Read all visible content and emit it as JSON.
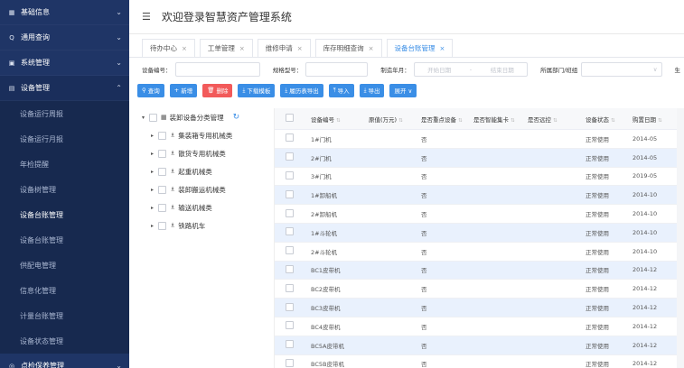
{
  "sidebar": {
    "groups_top": [
      {
        "icon": "▦",
        "label": "基础信息"
      },
      {
        "icon": "Q",
        "label": "通用查询"
      },
      {
        "icon": "▣",
        "label": "系统管理"
      }
    ],
    "equipment": {
      "icon": "▤",
      "label": "设备管理"
    },
    "sub_items": [
      "设备运行周报",
      "设备运行月报",
      "年检提醒",
      "设备树管理",
      "设备台账管理",
      "设备台账管理",
      "供配电管理",
      "信息化管理",
      "计量台账管理",
      "设备状态管理"
    ],
    "active_index": 4,
    "bottom_group": {
      "icon": "◎",
      "label": "点检保养管理"
    },
    "chevron_down": "⌄",
    "chevron_up": "⌃"
  },
  "header": {
    "menu_icon": "☰",
    "title": "欢迎登录智慧资产管理系统"
  },
  "tabs": [
    {
      "label": "待办中心",
      "active": false
    },
    {
      "label": "工单管理",
      "active": false
    },
    {
      "label": "维修申请",
      "active": false
    },
    {
      "label": "库存明细查询",
      "active": false
    },
    {
      "label": "设备台账管理",
      "active": true
    }
  ],
  "tab_close": "×",
  "filters": {
    "code_label": "设备编号：",
    "model_label": "规格型号：",
    "year_label": "制造年月：",
    "date_start": "开始日期",
    "date_sep": "-",
    "date_end": "结束日期",
    "dept_label": "所属部门/班组",
    "dept_arrow": "∨",
    "trailing": "生"
  },
  "actions": [
    {
      "icon": "⚲",
      "label": "查询",
      "color": "blue"
    },
    {
      "icon": "+",
      "label": "新增",
      "color": "blue"
    },
    {
      "icon": "🗑",
      "label": "删除",
      "color": "red"
    },
    {
      "icon": "⤓",
      "label": "下载模板",
      "color": "blue"
    },
    {
      "icon": "⤓",
      "label": "履历表导出",
      "color": "blue"
    },
    {
      "icon": "⤒",
      "label": "导入",
      "color": "blue"
    },
    {
      "icon": "⤓",
      "label": "导出",
      "color": "blue"
    },
    {
      "icon": "",
      "label": "展开 ∨",
      "color": "blue"
    }
  ],
  "tree": {
    "root": "装卸设备分类管理",
    "refresh_icon": "↻",
    "children": [
      "集装箱专用机械类",
      "散货专用机械类",
      "起重机械类",
      "装卸搬运机械类",
      "输送机械类",
      "铁路机车"
    ]
  },
  "table": {
    "headers": {
      "code": "设备编号",
      "orig": "原值(万元)",
      "key": "是否重点设备",
      "smart": "是否智能集卡",
      "remote": "是否远控",
      "status": "设备状态",
      "date": "购置日期"
    },
    "rows": [
      {
        "code": "1#门机",
        "key": "否",
        "status": "正常使用",
        "date": "2014-05"
      },
      {
        "code": "2#门机",
        "key": "否",
        "status": "正常使用",
        "date": "2014-05"
      },
      {
        "code": "3#门机",
        "key": "否",
        "status": "正常使用",
        "date": "2019-05"
      },
      {
        "code": "1#卸船机",
        "key": "否",
        "status": "正常使用",
        "date": "2014-10"
      },
      {
        "code": "2#卸船机",
        "key": "否",
        "status": "正常使用",
        "date": "2014-10"
      },
      {
        "code": "1#斗轮机",
        "key": "否",
        "status": "正常使用",
        "date": "2014-10"
      },
      {
        "code": "2#斗轮机",
        "key": "否",
        "status": "正常使用",
        "date": "2014-10"
      },
      {
        "code": "BC1皮带机",
        "key": "否",
        "status": "正常使用",
        "date": "2014-12"
      },
      {
        "code": "BC2皮带机",
        "key": "否",
        "status": "正常使用",
        "date": "2014-12"
      },
      {
        "code": "BC3皮带机",
        "key": "否",
        "status": "正常使用",
        "date": "2014-12"
      },
      {
        "code": "BC4皮带机",
        "key": "否",
        "status": "正常使用",
        "date": "2014-12"
      },
      {
        "code": "BC5A皮带机",
        "key": "否",
        "status": "正常使用",
        "date": "2014-12"
      },
      {
        "code": "BC5B皮带机",
        "key": "否",
        "status": "正常使用",
        "date": "2014-12"
      }
    ],
    "sort_icon": "⇅"
  },
  "colors": {
    "sidebar_bg": "#1f3566",
    "accent": "#3a8ee6",
    "danger": "#f25a5a",
    "row_alt": "#e9f1fd"
  }
}
